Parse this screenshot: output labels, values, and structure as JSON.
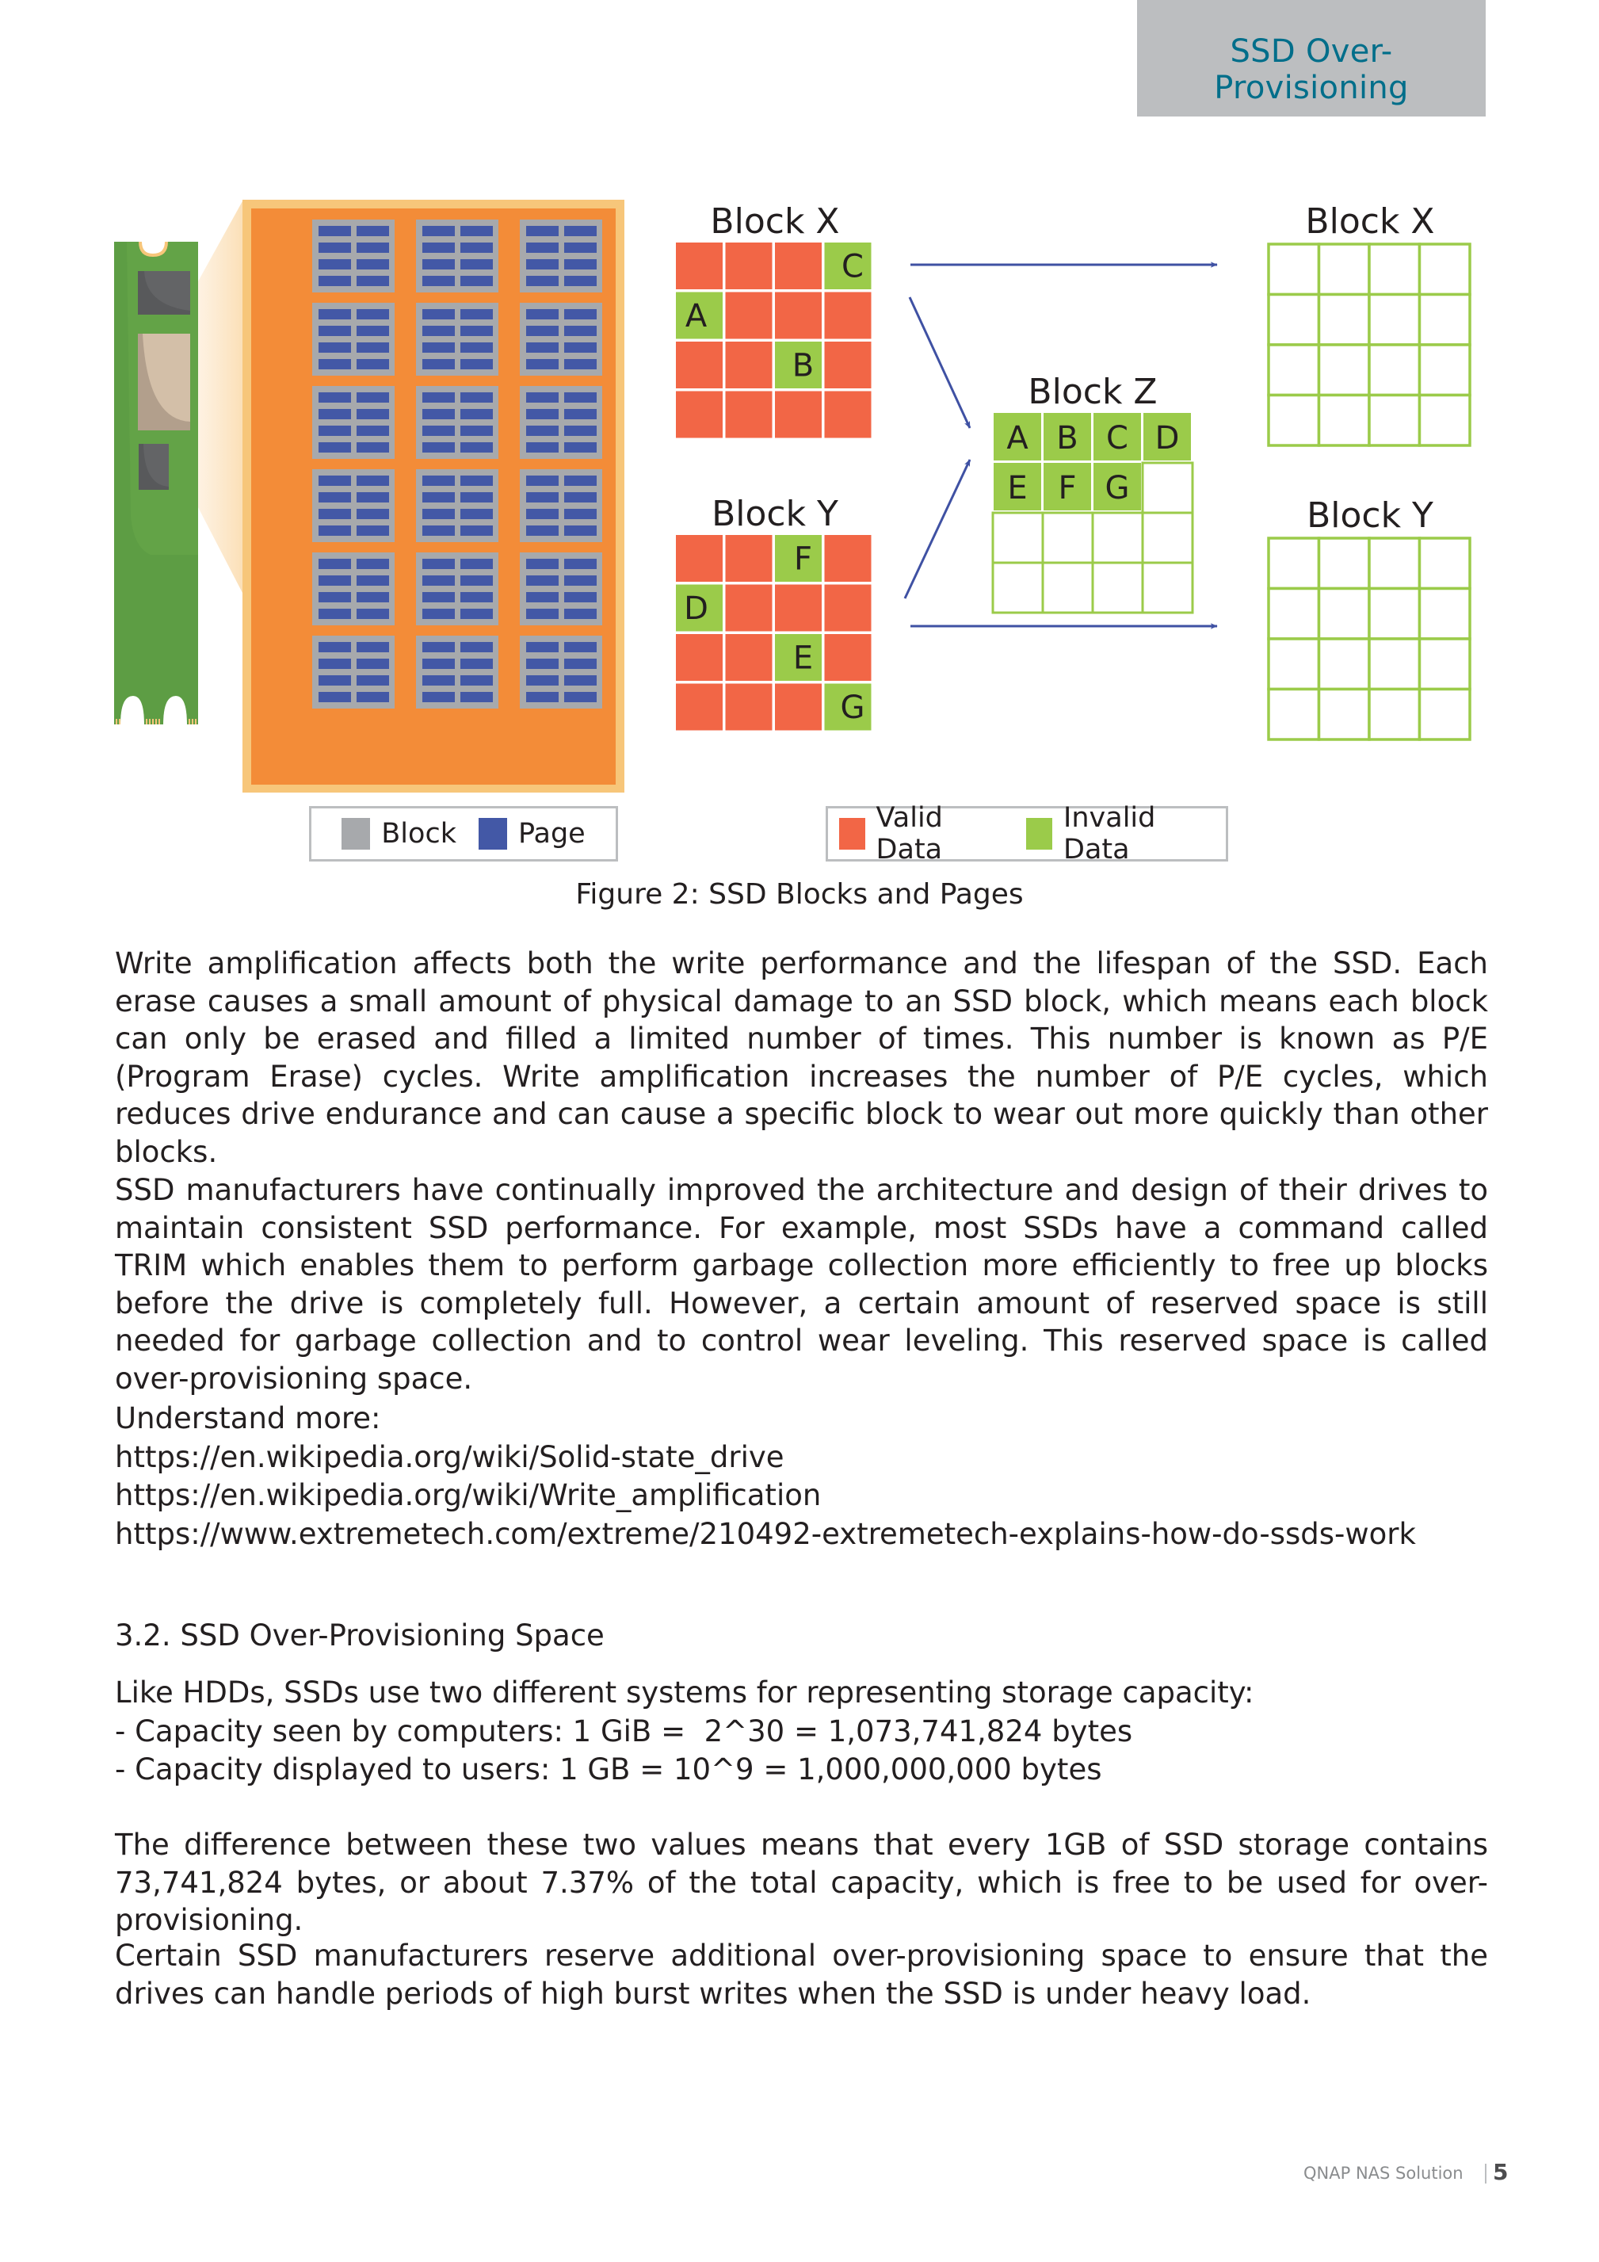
{
  "header": {
    "section_title": "SSD Over-Provisioning"
  },
  "colors": {
    "header_bg": "#bcbec0",
    "header_text": "#006e8a",
    "valid_data": "#f26646",
    "invalid_data": "#9bcb4a",
    "block_gray": "#a7a9ac",
    "page_blue": "#4358a6",
    "arrow_blue": "#3f51a3",
    "pcb_green": "#63a347",
    "chip_orange": "#f38c38",
    "chip_border": "#f7c67a"
  },
  "figure": {
    "caption": "Figure 2: SSD Blocks and Pages",
    "chip_grid": {
      "rows": 6,
      "cols": 3,
      "pages_per_block_rows": 4,
      "pages_per_block_cols": 2
    },
    "blocks_before": [
      {
        "title": "Block X",
        "cells": [
          [
            "valid",
            "valid",
            "valid",
            "invalid:C"
          ],
          [
            "invalid:A",
            "valid",
            "valid",
            "valid"
          ],
          [
            "valid",
            "valid",
            "invalid:B",
            "valid"
          ],
          [
            "valid",
            "valid",
            "valid",
            "valid"
          ]
        ]
      },
      {
        "title": "Block Y",
        "cells": [
          [
            "valid",
            "valid",
            "invalid:F",
            "valid"
          ],
          [
            "invalid:D",
            "valid",
            "valid",
            "valid"
          ],
          [
            "valid",
            "valid",
            "invalid:E",
            "valid"
          ],
          [
            "valid",
            "valid",
            "valid",
            "invalid:G"
          ]
        ]
      }
    ],
    "block_z": {
      "title": "Block Z",
      "cells": [
        [
          "A",
          "B",
          "C",
          "D"
        ],
        [
          "E",
          "F",
          "G",
          ""
        ],
        [
          "",
          "",
          "",
          ""
        ],
        [
          "",
          "",
          "",
          ""
        ]
      ]
    },
    "blocks_after": [
      {
        "title": "Block X"
      },
      {
        "title": "Block Y"
      }
    ],
    "legend_left": [
      {
        "label": "Block",
        "color": "#a7a9ac"
      },
      {
        "label": "Page",
        "color": "#4358a6"
      }
    ],
    "legend_right": [
      {
        "label": "Valid Data",
        "color": "#f26646"
      },
      {
        "label": "Invalid Data",
        "color": "#9bcb4a"
      }
    ]
  },
  "body": {
    "paragraph_1": "Write amplification affects both the write performance and the lifespan of the SSD. Each erase causes a small amount of physical damage to an SSD block, which means each block can only be erased and filled a limited number of times. This number is known as P/E (Program Erase) cycles. Write amplification increases the number of P/E cycles, which reduces drive endurance and can cause a specific block to wear out more quickly than other blocks.",
    "paragraph_2": "SSD manufacturers have continually improved the architecture and design of their drives to maintain consistent SSD performance. For example, most SSDs have a command called TRIM which enables them to perform garbage collection more efficiently to free up blocks before the drive is completely full. However, a certain amount of reserved space is still needed for garbage collection and to control wear leveling. This reserved space is called over-provisioning space.",
    "understand_more_label": "Understand more:",
    "links": [
      "https://en.wikipedia.org/wiki/Solid-state_drive",
      "https://en.wikipedia.org/wiki/Write_amplification",
      "https://www.extremetech.com/extreme/210492-extremetech-explains-how-do-ssds-work"
    ],
    "section_heading": "3.2. SSD Over-Provisioning Space",
    "capacity_intro": "Like HDDs, SSDs use two different systems for representing storage capacity:",
    "capacity_items": [
      "- Capacity seen by computers: 1 GiB =  2^30 = 1,073,741,824 bytes",
      "- Capacity displayed to users: 1 GB = 10^9 = 1,000,000,000 bytes"
    ],
    "paragraph_3": "The difference between these two values means that every 1GB of SSD storage contains 73,741,824 bytes, or about 7.37% of the total capacity, which is free to be used for over-provisioning.",
    "paragraph_4": "Certain SSD manufacturers reserve additional over-provisioning space to ensure that the drives can handle periods of high burst writes when the SSD is under heavy load."
  },
  "footer": {
    "brand": "QNAP NAS Solution",
    "page_number": "5"
  }
}
